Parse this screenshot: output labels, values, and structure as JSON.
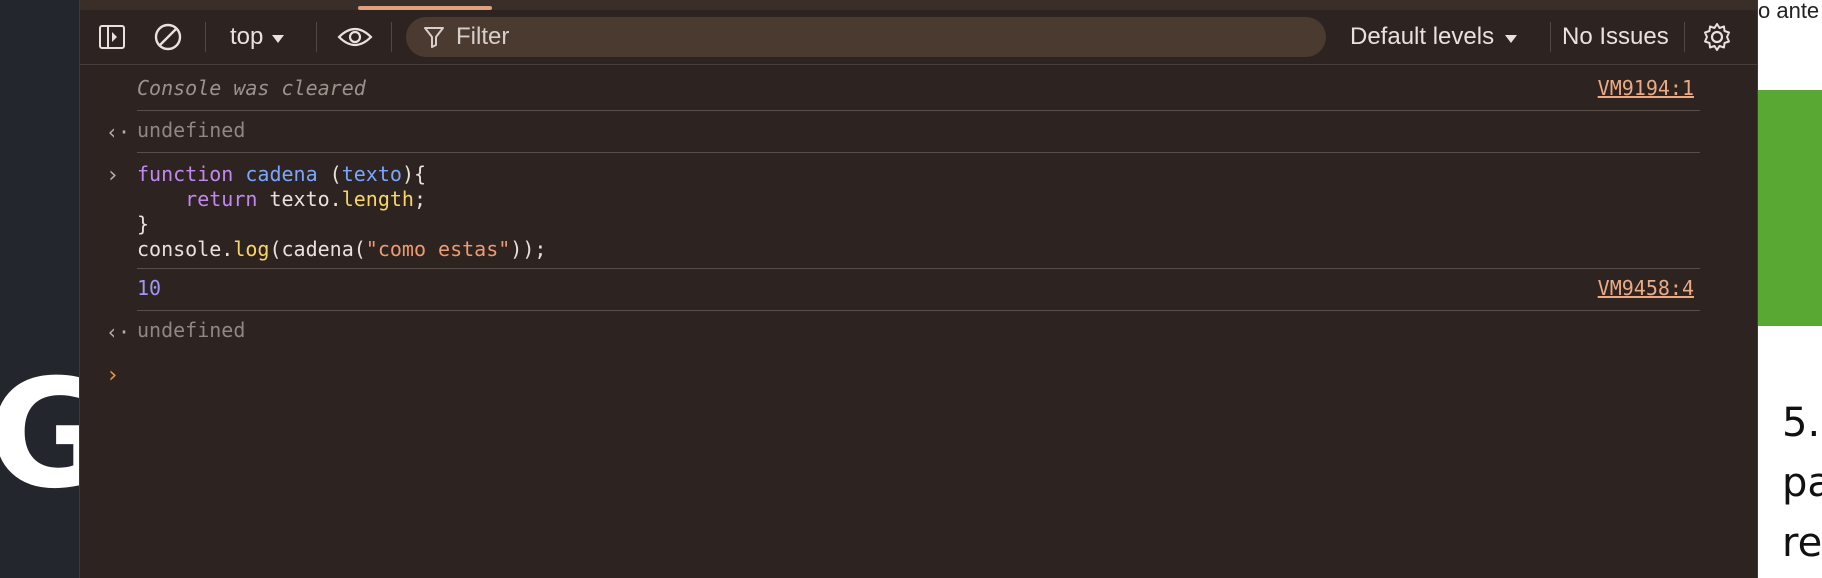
{
  "background": {
    "left_text": "GO",
    "right_snippet": "o ante",
    "right_number": "5.",
    "right_word_1": "pa",
    "right_word_2": "re"
  },
  "toolbar": {
    "dock_icon": "sidebar-toggle-icon",
    "clear_icon": "clear-console-icon",
    "context": "top",
    "eye_icon": "live-expression-icon",
    "filter_placeholder": "Filter",
    "levels": "Default levels",
    "issues": "No Issues",
    "settings_icon": "gear-icon"
  },
  "console": {
    "messages": [
      {
        "text": "Console was cleared",
        "source": "VM9194:1"
      },
      {
        "text": "undefined"
      },
      {
        "code": [
          "function cadena (texto){",
          "    return texto.length;",
          "}",
          "console.log(cadena(\"como estas\"));"
        ]
      },
      {
        "text": "10",
        "source": "VM9458:4"
      },
      {
        "text": "undefined"
      }
    ]
  },
  "colors": {
    "panel_bg": "#2d2320",
    "filter_bg": "#4a3a30",
    "link": "#eaaa86",
    "keyword": "#c189ee",
    "function": "#7aa6ff",
    "property": "#f6d56b",
    "string": "#ee9a72",
    "number": "#9f97f7",
    "prompt": "#e39a4c"
  }
}
